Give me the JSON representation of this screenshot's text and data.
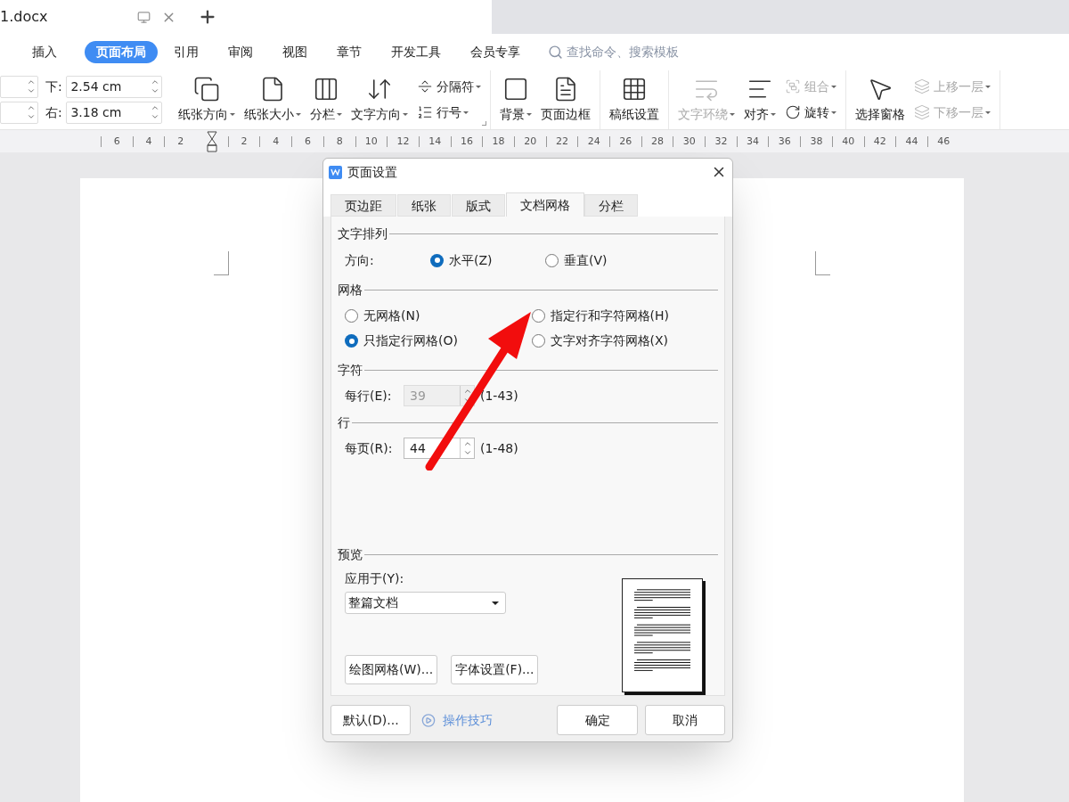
{
  "tabbar": {
    "document_tab": {
      "title": "1.docx",
      "selected": true
    }
  },
  "menu": {
    "items": [
      {
        "label": "插入",
        "selected": false
      },
      {
        "label": "页面布局",
        "selected": true
      },
      {
        "label": "引用",
        "selected": false
      },
      {
        "label": "审阅",
        "selected": false
      },
      {
        "label": "视图",
        "selected": false
      },
      {
        "label": "章节",
        "selected": false
      },
      {
        "label": "开发工具",
        "selected": false
      },
      {
        "label": "会员专享",
        "selected": false
      }
    ],
    "search": {
      "placeholder": "查找命令、搜索模板"
    }
  },
  "ribbon": {
    "groups": [
      {
        "kind": "margins",
        "rows": [
          {
            "label": "下:",
            "value": "2.54 cm"
          },
          {
            "label": "右:",
            "value": "3.18 cm"
          }
        ]
      },
      {
        "kind": "buttons",
        "launcher": true,
        "items": [
          {
            "kind": "big",
            "label": "纸张方向",
            "dropdown": true,
            "disabled": false
          },
          {
            "kind": "big",
            "label": "纸张大小",
            "dropdown": true,
            "disabled": false
          },
          {
            "kind": "big",
            "label": "分栏",
            "dropdown": true,
            "disabled": false
          },
          {
            "kind": "big",
            "label": "文字方向",
            "dropdown": true,
            "disabled": false
          },
          {
            "kind": "stack",
            "items": [
              {
                "label": "分隔符",
                "dropdown": true,
                "disabled": false
              },
              {
                "label": "行号",
                "dropdown": true,
                "disabled": false
              }
            ]
          }
        ]
      },
      {
        "kind": "buttons",
        "launcher": false,
        "items": [
          {
            "kind": "big",
            "label": "背景",
            "dropdown": true,
            "disabled": false
          },
          {
            "kind": "big",
            "label": "页面边框",
            "dropdown": false,
            "disabled": false
          }
        ]
      },
      {
        "kind": "buttons",
        "launcher": false,
        "items": [
          {
            "kind": "big",
            "label": "稿纸设置",
            "dropdown": false,
            "disabled": false
          }
        ]
      },
      {
        "kind": "buttons",
        "launcher": false,
        "items": [
          {
            "kind": "big",
            "label": "文字环绕",
            "dropdown": true,
            "disabled": true
          },
          {
            "kind": "big",
            "label": "对齐",
            "dropdown": true,
            "disabled": false
          },
          {
            "kind": "stack",
            "items": [
              {
                "label": "组合",
                "dropdown": true,
                "disabled": true
              },
              {
                "label": "旋转",
                "dropdown": true,
                "disabled": false
              }
            ]
          }
        ]
      },
      {
        "kind": "buttons",
        "launcher": false,
        "items": [
          {
            "kind": "big",
            "label": "选择窗格",
            "dropdown": false,
            "disabled": false
          },
          {
            "kind": "stack",
            "items": [
              {
                "label": "上移一层",
                "dropdown": true,
                "disabled": true
              },
              {
                "label": "下移一层",
                "dropdown": true,
                "disabled": true
              }
            ]
          }
        ]
      }
    ]
  },
  "ruler": {
    "labels": [
      "6",
      "4",
      "2",
      "2",
      "4",
      "6",
      "8",
      "10",
      "12",
      "14",
      "16",
      "18",
      "20",
      "22",
      "24",
      "26",
      "28",
      "30",
      "32",
      "34",
      "36",
      "38",
      "40",
      "42",
      "44",
      "46"
    ]
  },
  "dialog": {
    "title": "页面设置",
    "tabs": [
      {
        "label": "页边距",
        "selected": false
      },
      {
        "label": "纸张",
        "selected": false
      },
      {
        "label": "版式",
        "selected": false
      },
      {
        "label": "文档网格",
        "selected": true
      },
      {
        "label": "分栏",
        "selected": false
      }
    ],
    "text_layout": {
      "label": "文字排列",
      "direction_label": "方向:",
      "options": [
        {
          "label": "水平(Z)",
          "selected": true
        },
        {
          "label": "垂直(V)",
          "selected": false
        }
      ]
    },
    "grid": {
      "label": "网格",
      "options": [
        {
          "label": "无网格(N)",
          "selected": false
        },
        {
          "label": "指定行和字符网格(H)",
          "selected": false
        },
        {
          "label": "只指定行网格(O)",
          "selected": true
        },
        {
          "label": "文字对齐字符网格(X)",
          "selected": false
        }
      ]
    },
    "characters": {
      "label": "字符",
      "field_label": "每行(E):",
      "value": "39",
      "disabled": true,
      "range": "(1-43)"
    },
    "lines": {
      "label": "行",
      "field_label": "每页(R):",
      "value": "44",
      "disabled": false,
      "range": "(1-48)"
    },
    "preview": {
      "label": "预览",
      "apply_label": "应用于(Y):",
      "apply_value": "整篇文档"
    },
    "buttons": [
      "绘图网格(W)...",
      "字体设置(F)..."
    ],
    "footer": {
      "default": "默认(D)...",
      "tips": "操作技巧",
      "ok": "确定",
      "cancel": "取消"
    }
  }
}
